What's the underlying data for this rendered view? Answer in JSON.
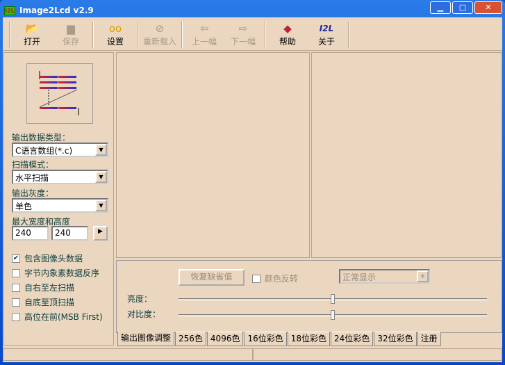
{
  "window": {
    "title": "Image2Lcd v2.9",
    "logo": "I2L"
  },
  "toolbar": [
    {
      "label": "打开",
      "icon": "open-folder-icon",
      "enabled": true
    },
    {
      "label": "保存",
      "icon": "save-icon",
      "enabled": false
    },
    {
      "label": "设置",
      "icon": "glasses-icon",
      "enabled": true
    },
    {
      "label": "重新载入",
      "icon": "reload-icon",
      "enabled": false
    },
    {
      "label": "上一幅",
      "icon": "prev-arrow-icon",
      "enabled": false
    },
    {
      "label": "下一幅",
      "icon": "next-arrow-icon",
      "enabled": false
    },
    {
      "label": "帮助",
      "icon": "help-book-icon",
      "enabled": true
    },
    {
      "label": "关于",
      "icon": "about-i2l-icon",
      "enabled": true,
      "glyph": "I2L"
    }
  ],
  "left": {
    "output_type_label": "输出数据类型：",
    "output_type": "C语言数组(*.c)",
    "scan_mode_label": "扫描模式：",
    "scan_mode": "水平扫描",
    "gray_label": "输出灰度：",
    "gray": "单色",
    "size_label": "最大宽度和高度",
    "width": "240",
    "height": "240",
    "checks": [
      {
        "label": "包含图像头数据",
        "checked": true
      },
      {
        "label": "字节内象素数据反序",
        "checked": false
      },
      {
        "label": "自右至左扫描",
        "checked": false
      },
      {
        "label": "自底至顶扫描",
        "checked": false
      },
      {
        "label": "高位在前(MSB First)",
        "checked": false
      }
    ]
  },
  "adjust": {
    "reset_label": "恢复缺省值",
    "invert_label": "颜色反转",
    "display_mode": "正常显示",
    "brightness_label": "亮度：",
    "brightness": 0.5,
    "contrast_label": "对比度：",
    "contrast": 0.5
  },
  "tabs": [
    "输出图像调整",
    "256色",
    "4096色",
    "16位彩色",
    "18位彩色",
    "24位彩色",
    "32位彩色",
    "注册"
  ],
  "colors": {
    "face": "#ebd6c0",
    "title": "#0848c8"
  }
}
